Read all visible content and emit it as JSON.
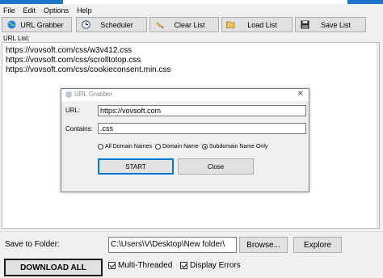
{
  "menu": [
    "File",
    "Edit",
    "Options",
    "Help"
  ],
  "toolbar": {
    "url_grabber": "URL Grabber",
    "scheduler": "Scheduler",
    "clear_list": "Clear List",
    "load_list": "Load List",
    "save_list": "Save List"
  },
  "url_list": {
    "label": "URL List:",
    "items": [
      "https://vovsoft.com/css/w3v412.css",
      "https://vovsoft.com/css/scrolltotop.css",
      "https://vovsoft.com/css/cookieconsent.min.css"
    ]
  },
  "dialog": {
    "title": "URL Grabber",
    "close_glyph": "✕",
    "url_label": "URL:",
    "url_value": "https://vovsoft.com",
    "contains_label": "Contains:",
    "contains_value": ".css",
    "radios": [
      "All Domain Names",
      "Domain Name",
      "Subdomain Name Only"
    ],
    "selected_radio": "Subdomain Name Only",
    "start": "START",
    "close": "Close"
  },
  "bottom": {
    "save_label": "Save to Folder:",
    "folder_value": "C:\\Users\\V\\Desktop\\New folder\\",
    "browse": "Browse...",
    "explore": "Explore",
    "download": "DOWNLOAD ALL",
    "multi_threaded": "Multi-Threaded",
    "display_errors": "Display Errors"
  },
  "colors": {
    "accent": "#0078d7",
    "title_accent": "#1e74c8"
  }
}
